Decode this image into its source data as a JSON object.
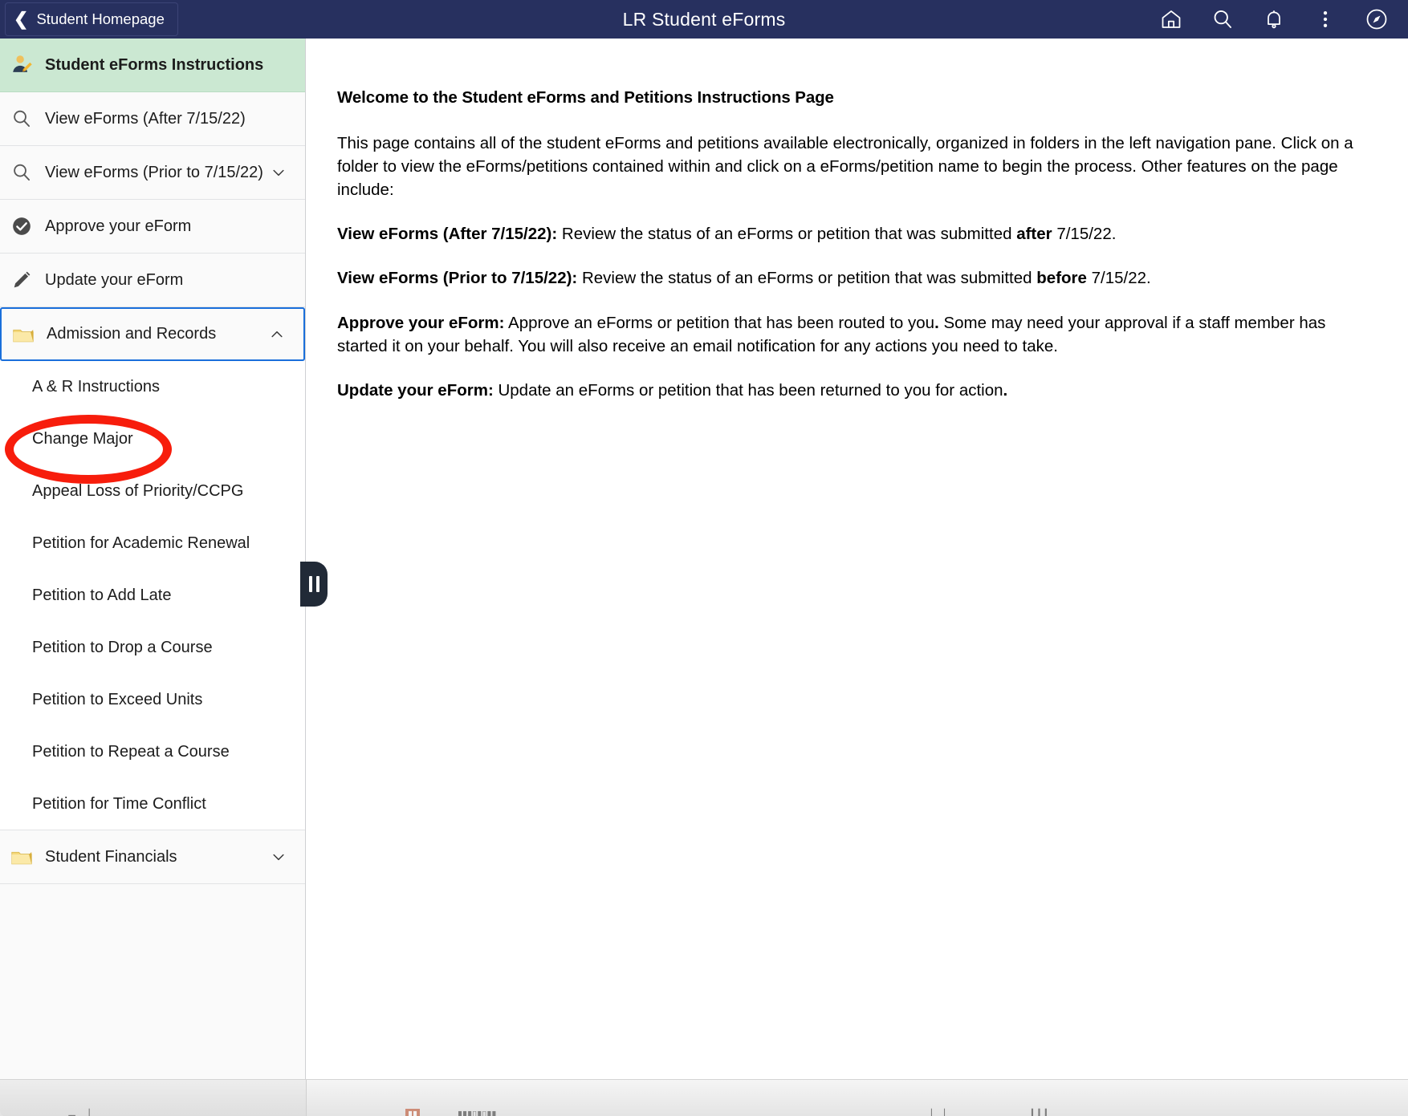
{
  "header": {
    "back_label": "Student Homepage",
    "back_icon": "chevron-left-icon",
    "title": "LR Student eForms",
    "icons": [
      {
        "name": "home-icon",
        "label": "Home"
      },
      {
        "name": "search-icon",
        "label": "Search"
      },
      {
        "name": "notifications-bell-icon",
        "label": "Notifications"
      },
      {
        "name": "more-actions-icon",
        "label": "Actions"
      },
      {
        "name": "navbar-compass-icon",
        "label": "NavBar"
      }
    ],
    "background_color": "#27305f"
  },
  "sidebar": {
    "items": [
      {
        "label": "Student eForms Instructions",
        "icon": "student-writing-icon",
        "selected": true,
        "chevron": null
      },
      {
        "label": "View eForms (After 7/15/22)",
        "icon": "magnifier-icon",
        "selected": false,
        "chevron": null
      },
      {
        "label": "View eForms (Prior to 7/15/22)",
        "icon": "magnifier-icon",
        "selected": false,
        "chevron": "chevron-down-icon"
      },
      {
        "label": "Approve your eForm",
        "icon": "check-circle-icon",
        "selected": false,
        "chevron": null
      },
      {
        "label": "Update your eForm",
        "icon": "pencil-icon",
        "selected": false,
        "chevron": null
      },
      {
        "label": "Admission and Records",
        "icon": "folder-icon",
        "selected": false,
        "expanded": true,
        "chevron": "chevron-up-icon"
      }
    ],
    "children": [
      {
        "label": "A & R Instructions",
        "highlighted": false
      },
      {
        "label": "Change Major",
        "highlighted": true
      },
      {
        "label": "Appeal Loss of Priority/CCPG",
        "highlighted": false
      },
      {
        "label": "Petition for Academic Renewal",
        "highlighted": false
      },
      {
        "label": "Petition to Add Late",
        "highlighted": false
      },
      {
        "label": "Petition to Drop a Course",
        "highlighted": false
      },
      {
        "label": "Petition to Exceed Units",
        "highlighted": false
      },
      {
        "label": "Petition to Repeat a Course",
        "highlighted": false
      },
      {
        "label": "Petition for Time Conflict",
        "highlighted": false
      }
    ],
    "footer_items": [
      {
        "label": "Student Financials",
        "icon": "folder-icon",
        "chevron": "chevron-down-icon"
      }
    ],
    "selected_background": "#cbe8d2",
    "focus_outline_color": "#1a6fdb"
  },
  "annotation": {
    "shape": "ellipse",
    "color": "#f71d0c",
    "target_label": "Change Major"
  },
  "collapse_handle": {
    "name": "sidebar-collapse-handle",
    "glyph": "pause-bars"
  },
  "main": {
    "heading": "Welcome to the Student eForms and Petitions Instructions Page",
    "paragraphs": [
      {
        "parts": [
          {
            "text": "This page contains all of the student eForms and petitions available electronically, organized in folders in the left navigation pane. Click on a folder to view the eForms/petitions contained within and click on a eForms/petition name to begin the process. Other features on the page include:",
            "bold": false
          }
        ]
      },
      {
        "parts": [
          {
            "text": "View eForms (After 7/15/22):",
            "bold": true
          },
          {
            "text": " Review the status of an eForms or petition that was submitted ",
            "bold": false
          },
          {
            "text": "after",
            "bold": true
          },
          {
            "text": " 7/15/22.",
            "bold": false
          }
        ]
      },
      {
        "parts": [
          {
            "text": "View eForms (Prior to 7/15/22):",
            "bold": true
          },
          {
            "text": " Review the status of an eForms or petition that was submitted ",
            "bold": false
          },
          {
            "text": "before",
            "bold": true
          },
          {
            "text": " 7/15/22.",
            "bold": false
          }
        ]
      },
      {
        "parts": [
          {
            "text": "Approve your eForm:",
            "bold": true
          },
          {
            "text": " Approve an eForms or petition that has been routed to you",
            "bold": false
          },
          {
            "text": ".",
            "bold": true
          },
          {
            "text": " Some may need your approval if a staff member has started it on your behalf. You will also receive an email notification for any actions you need to take.",
            "bold": false
          }
        ]
      },
      {
        "parts": [
          {
            "text": "Update your eForm:",
            "bold": true
          },
          {
            "text": " Update an eForms or petition that has been returned to you for action",
            "bold": false
          },
          {
            "text": ".",
            "bold": true
          }
        ]
      }
    ]
  }
}
